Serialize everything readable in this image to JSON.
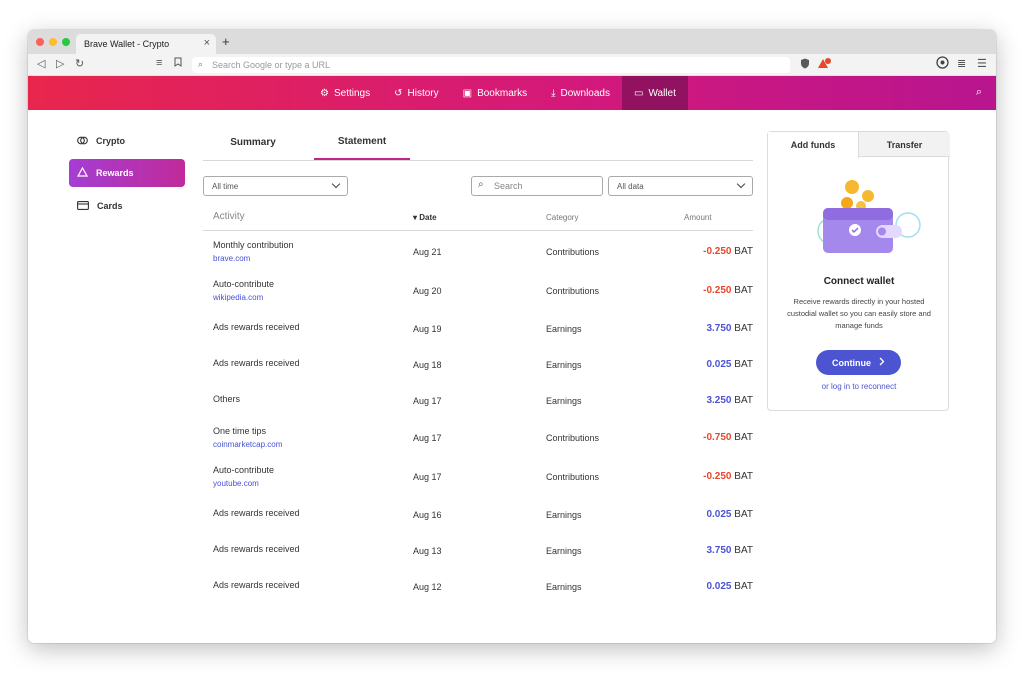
{
  "browser": {
    "tab_title": "Brave Wallet - Crypto",
    "tab_close": "×",
    "new_tab": "+",
    "url_placeholder": "Search Google or type a URL"
  },
  "nav": {
    "items": [
      {
        "label": "Settings",
        "icon": "gear-icon"
      },
      {
        "label": "History",
        "icon": "history-icon"
      },
      {
        "label": "Bookmarks",
        "icon": "bookmark-icon"
      },
      {
        "label": "Downloads",
        "icon": "download-icon"
      },
      {
        "label": "Wallet",
        "icon": "wallet-icon"
      }
    ]
  },
  "sidebar": {
    "items": [
      {
        "label": "Crypto",
        "icon": "crypto-icon"
      },
      {
        "label": "Rewards",
        "icon": "rewards-triangle-icon"
      },
      {
        "label": "Cards",
        "icon": "card-icon"
      }
    ]
  },
  "tabs": {
    "summary": "Summary",
    "statement": "Statement"
  },
  "filters": {
    "time": "All time",
    "search_placeholder": "Search",
    "data": "All data"
  },
  "table": {
    "headers": {
      "activity": "Activity",
      "date": "Date",
      "category": "Category",
      "amount": "Amount"
    },
    "sort_indicator": "▾",
    "rows": [
      {
        "activity": "Monthly contribution",
        "source": "brave.com",
        "date": "Aug 21",
        "category": "Contributions",
        "amount": "-0.250",
        "unit": "BAT"
      },
      {
        "activity": "Auto-contribute",
        "source": "wikipedia.com",
        "date": "Aug 20",
        "category": "Contributions",
        "amount": "-0.250",
        "unit": "BAT"
      },
      {
        "activity": "Ads rewards received",
        "source": "",
        "date": "Aug 19",
        "category": "Earnings",
        "amount": "3.750",
        "unit": "BAT"
      },
      {
        "activity": "Ads rewards received",
        "source": "",
        "date": "Aug 18",
        "category": "Earnings",
        "amount": "0.025",
        "unit": "BAT"
      },
      {
        "activity": "Others",
        "source": "",
        "date": "Aug 17",
        "category": "Earnings",
        "amount": "3.250",
        "unit": "BAT"
      },
      {
        "activity": "One time tips",
        "source": "coinmarketcap.com",
        "date": "Aug 17",
        "category": "Contributions",
        "amount": "-0.750",
        "unit": "BAT"
      },
      {
        "activity": "Auto-contribute",
        "source": "youtube.com",
        "date": "Aug 17",
        "category": "Contributions",
        "amount": "-0.250",
        "unit": "BAT"
      },
      {
        "activity": "Ads rewards received",
        "source": "",
        "date": "Aug 16",
        "category": "Earnings",
        "amount": "0.025",
        "unit": "BAT"
      },
      {
        "activity": "Ads rewards received",
        "source": "",
        "date": "Aug 13",
        "category": "Earnings",
        "amount": "3.750",
        "unit": "BAT"
      },
      {
        "activity": "Ads rewards received",
        "source": "",
        "date": "Aug 12",
        "category": "Earnings",
        "amount": "0.025",
        "unit": "BAT"
      }
    ]
  },
  "panel": {
    "tab_add": "Add funds",
    "tab_transfer": "Transfer",
    "title": "Connect wallet",
    "description": "Receive rewards directly in your hosted custodial wallet so you can easily store and manage funds",
    "button": "Continue",
    "link": "or log in to reconnect"
  },
  "colors": {
    "negative": "#e8472b",
    "positive": "#4c54d2",
    "accent": "#c0268a"
  }
}
